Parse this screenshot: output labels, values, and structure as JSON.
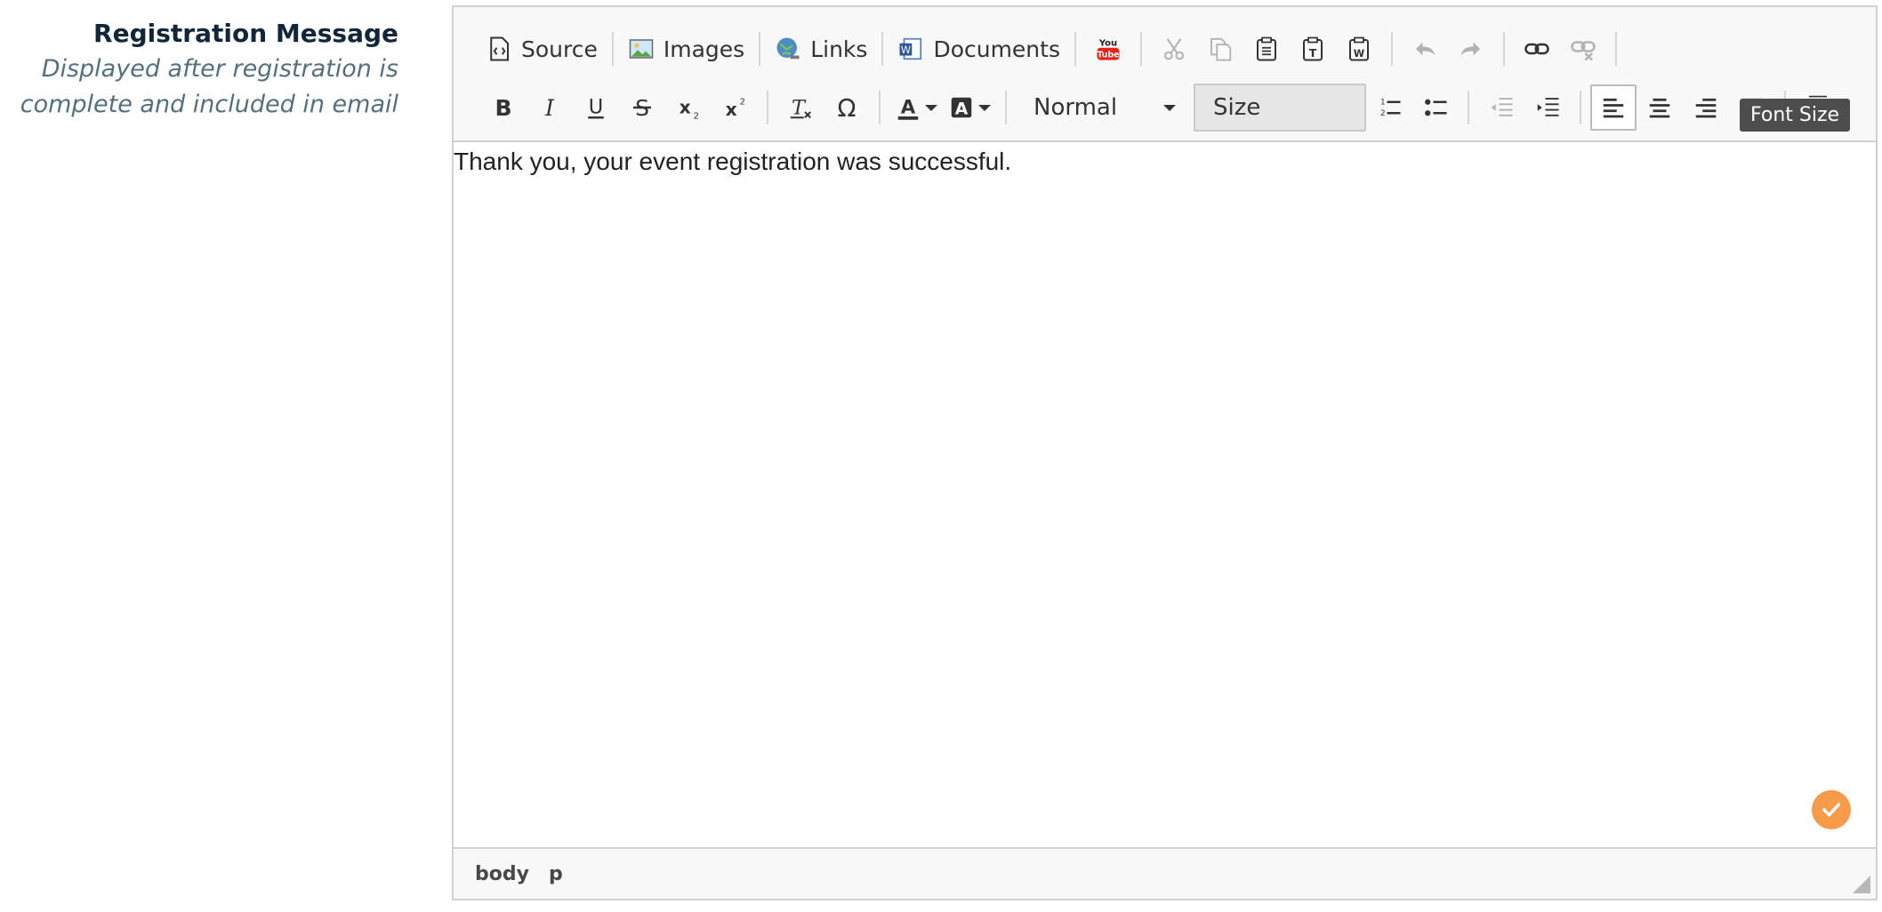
{
  "field": {
    "title": "Registration Message",
    "description_line1": "Displayed after registration is",
    "description_line2": "complete and included in email"
  },
  "toolbar": {
    "source_label": "Source",
    "images_label": "Images",
    "links_label": "Links",
    "documents_label": "Documents",
    "format_value": "Normal",
    "size_value": "Size",
    "tooltip": "Font Size"
  },
  "content": {
    "text": "Thank you, your event registration was successful."
  },
  "path": [
    "body",
    "p"
  ],
  "colors": {
    "accent": "#f79a4a",
    "label": "#12263a",
    "description": "#54707e"
  }
}
